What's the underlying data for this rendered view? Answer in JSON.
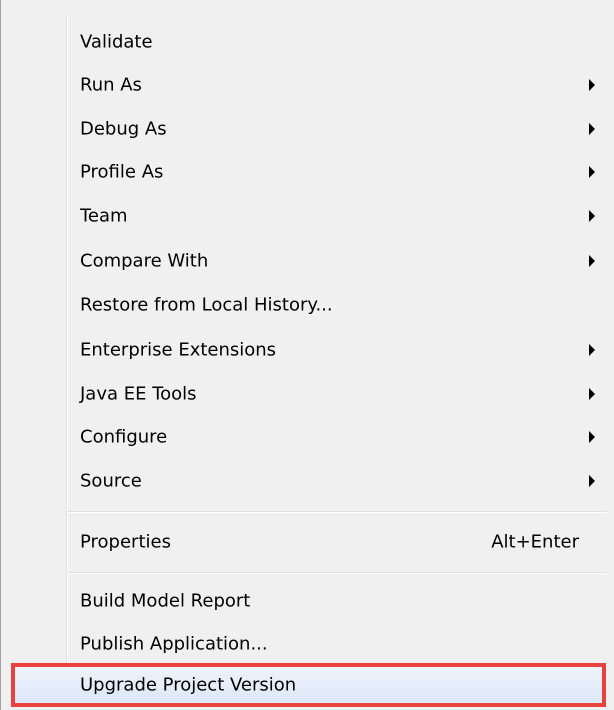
{
  "menu": {
    "items": [
      {
        "label": "Validate",
        "submenu": false
      },
      {
        "label": "Run As",
        "submenu": true
      },
      {
        "label": "Debug As",
        "submenu": true
      },
      {
        "label": "Profile As",
        "submenu": true
      },
      {
        "label": "Team",
        "submenu": true
      },
      {
        "label": "Compare With",
        "submenu": true
      },
      {
        "label": "Restore from Local History...",
        "submenu": false
      },
      {
        "label": "Enterprise Extensions",
        "submenu": true
      },
      {
        "label": "Java EE Tools",
        "submenu": true
      },
      {
        "label": "Configure",
        "submenu": true
      },
      {
        "label": "Source",
        "submenu": true
      }
    ],
    "properties": {
      "label": "Properties",
      "shortcut": "Alt+Enter"
    },
    "bottom_items": [
      {
        "label": "Build Model Report"
      },
      {
        "label": "Publish Application..."
      },
      {
        "label": "Upgrade Project Version",
        "highlighted": true
      }
    ]
  },
  "colors": {
    "menu_background": "#f0f0f0",
    "highlight_border": "#e8423f",
    "submenu_arrow": "#000000"
  },
  "icons": {
    "submenu_arrow": "chevron-right-icon"
  }
}
